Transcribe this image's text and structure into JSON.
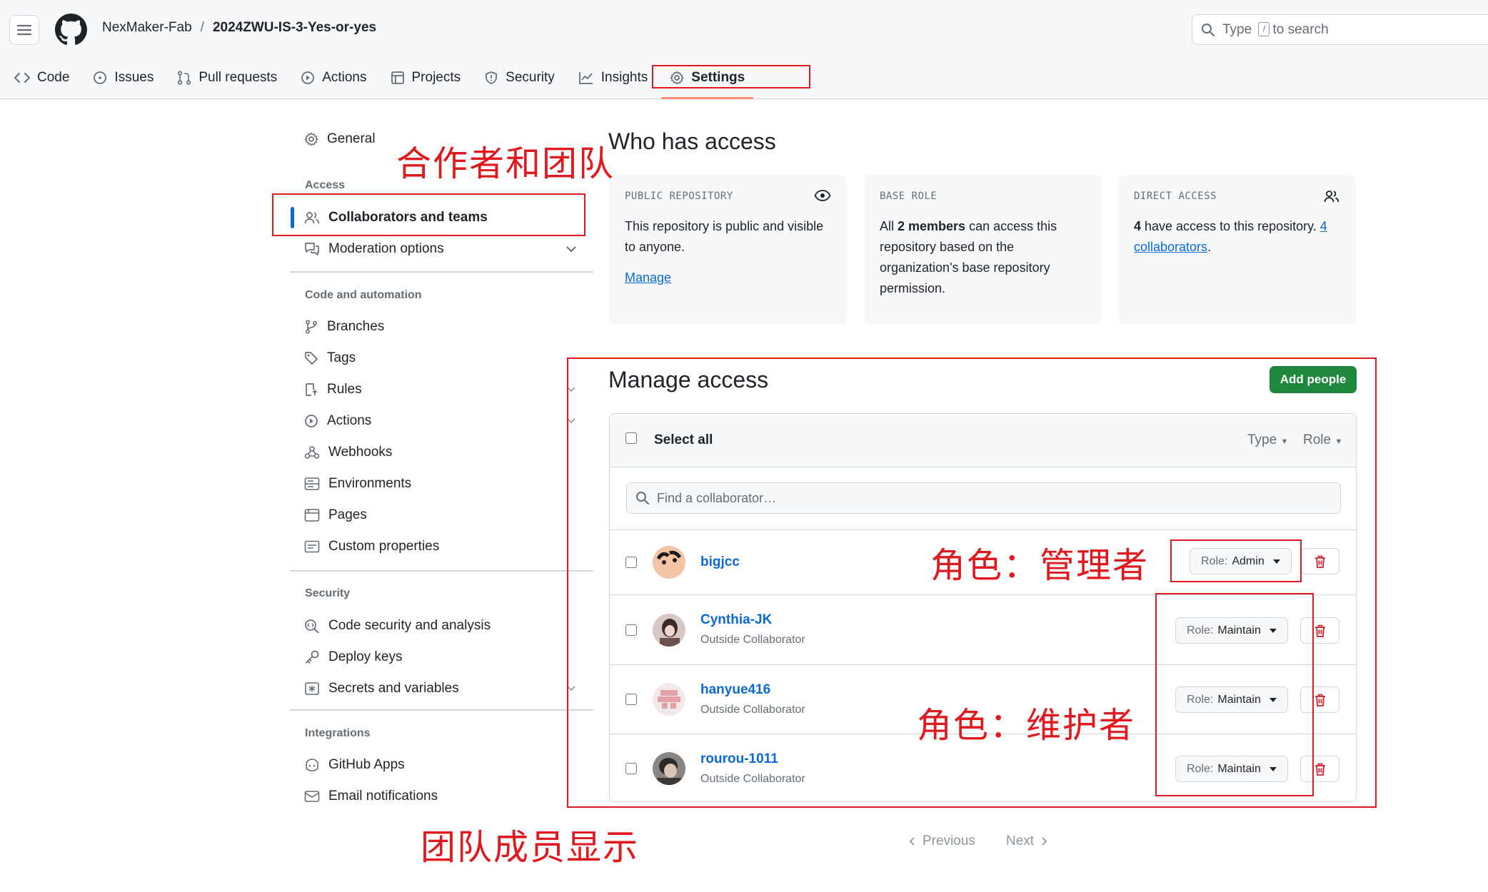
{
  "header": {
    "owner": "NexMaker-Fab",
    "separator": "/",
    "repo": "2024ZWU-IS-3-Yes-or-yes",
    "search": {
      "prefix": "Type",
      "key": "/",
      "suffix": "to search"
    }
  },
  "tabs": [
    {
      "label": "Code",
      "icon": "code-icon"
    },
    {
      "label": "Issues",
      "icon": "issue-icon"
    },
    {
      "label": "Pull requests",
      "icon": "pull-request-icon"
    },
    {
      "label": "Actions",
      "icon": "play-icon"
    },
    {
      "label": "Projects",
      "icon": "table-icon"
    },
    {
      "label": "Security",
      "icon": "shield-icon"
    },
    {
      "label": "Insights",
      "icon": "graph-icon"
    },
    {
      "label": "Settings",
      "icon": "gear-icon",
      "active": true
    }
  ],
  "sidebar": {
    "general": "General",
    "access_heading": "Access",
    "collaborators": "Collaborators and teams",
    "moderation": "Moderation options",
    "code_heading": "Code and automation",
    "code_items": [
      "Branches",
      "Tags",
      "Rules",
      "Actions",
      "Webhooks",
      "Environments",
      "Pages",
      "Custom properties"
    ],
    "security_heading": "Security",
    "security_items": [
      "Code security and analysis",
      "Deploy keys",
      "Secrets and variables"
    ],
    "integrations_heading": "Integrations",
    "integration_items": [
      "GitHub Apps",
      "Email notifications"
    ]
  },
  "who_has_access": {
    "title": "Who has access",
    "public": {
      "label": "PUBLIC REPOSITORY",
      "text": "This repository is public and visible to anyone.",
      "link": "Manage"
    },
    "base_role": {
      "label": "BASE ROLE",
      "pre": "All ",
      "bold": "2 members",
      "post": " can access this repository based on the organization's base repository permission."
    },
    "direct": {
      "label": "DIRECT ACCESS",
      "bold": "4",
      "pre": " have access to this repository. ",
      "link": "4 collaborators",
      "post": "."
    }
  },
  "manage_access": {
    "title": "Manage access",
    "add_button": "Add people",
    "select_all": "Select all",
    "filter_type": "Type",
    "filter_role": "Role",
    "find_placeholder": "Find a collaborator…",
    "collaborators": [
      {
        "name": "bigjcc",
        "subtitle": "",
        "role_prefix": "Role:",
        "role": "Admin"
      },
      {
        "name": "Cynthia-JK",
        "subtitle": "Outside Collaborator",
        "role_prefix": "Role:",
        "role": "Maintain"
      },
      {
        "name": "hanyue416",
        "subtitle": "Outside Collaborator",
        "role_prefix": "Role:",
        "role": "Maintain"
      },
      {
        "name": "rourou-1011",
        "subtitle": "Outside Collaborator",
        "role_prefix": "Role:",
        "role": "Maintain"
      }
    ],
    "pager": {
      "previous": "Previous",
      "next": "Next"
    }
  },
  "annotations": {
    "collaborators_teams": "合作者和团队",
    "role_admin": "角色：管理者",
    "role_maintain": "角色：维护者",
    "team_display": "团队成员显示"
  },
  "colors": {
    "accent": "#0969da",
    "primary_button": "#1f883d",
    "annotation_red": "#e0191f",
    "danger": "#cf222e"
  }
}
